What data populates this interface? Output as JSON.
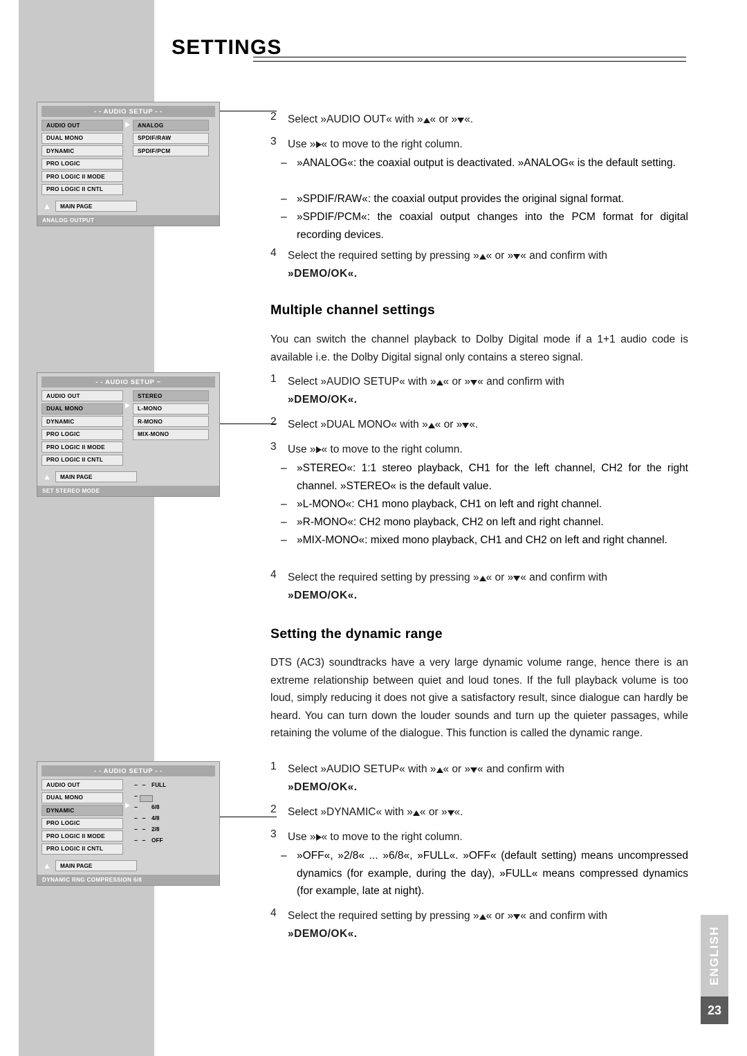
{
  "header": {
    "title": "SETTINGS"
  },
  "footer": {
    "language_tab": "ENGLISH",
    "page_number": "23"
  },
  "osd_panels": [
    {
      "title": "- - AUDIO SETUP - -",
      "left_items": [
        "AUDIO OUT",
        "DUAL MONO",
        "DYNAMIC",
        "PRO LOGIC",
        "PRO LOGIC II MODE",
        "PRO LOGIC II CNTL"
      ],
      "selected_left": "AUDIO OUT",
      "right_items": [
        "ANALOG",
        "SPDIF/RAW",
        "SPDIF/PCM"
      ],
      "selected_right": "ANALOG",
      "main_page": "MAIN PAGE",
      "status": "ANALOG OUTPUT"
    },
    {
      "title": "- - AUDIO SETUP ~",
      "left_items": [
        "AUDIO OUT",
        "DUAL MONO",
        "DYNAMIC",
        "PRO LOGIC",
        "PRO LOGIC II MODE",
        "PRO LOGIC II CNTL"
      ],
      "selected_left": "DUAL MONO",
      "right_items": [
        "STEREO",
        "L-MONO",
        "R-MONO",
        "MIX-MONO"
      ],
      "selected_right": "STEREO",
      "main_page": "MAIN PAGE",
      "status": "SET STEREO MODE"
    },
    {
      "title": "- - AUDIO SETUP - -",
      "left_items": [
        "AUDIO OUT",
        "DUAL MONO",
        "DYNAMIC",
        "PRO LOGIC",
        "PRO LOGIC II MODE",
        "PRO LOGIC II CNTL"
      ],
      "selected_left": "DYNAMIC",
      "scale_labels": [
        "FULL",
        "6/8",
        "4/8",
        "2/8",
        "OFF"
      ],
      "main_page": "MAIN PAGE",
      "status": "DYNAMIC RNG COMPRESSION 6/8"
    }
  ],
  "content": {
    "step2_audioout": {
      "num": "2",
      "text_a": "Select »AUDIO OUT« with »",
      "text_b": "« or »",
      "text_c": "«."
    },
    "step3_right_column": {
      "num": "3",
      "text_a": "Use »",
      "text_b": "« to move to the right column."
    },
    "bullets_audioout": [
      "»ANALOG«: the coaxial output is deactivated. »ANALOG« is the default setting.",
      "»SPDIF/RAW«: the coaxial output provides the original signal format.",
      "»SPDIF/PCM«: the coaxial output changes into the PCM format for digital recording devices."
    ],
    "step4": {
      "num": "4",
      "text_a": "Select the required setting by pressing »",
      "text_b": "« or »",
      "text_c": "« and confirm with",
      "demo_ok": "»DEMO/OK«."
    },
    "section_multiple": {
      "heading": "Multiple channel settings",
      "paragraph": "You can switch the channel playback to Dolby Digital mode if a 1+1 audio code is available i.e. the Dolby Digital signal only contains a stereo signal."
    },
    "step1_audiosetup": {
      "num": "1",
      "text_a": "Select »AUDIO SETUP« with »",
      "text_b": "« or »",
      "text_c": "« and confirm with",
      "demo_ok": "»DEMO/OK«."
    },
    "step2_dualmono": {
      "num": "2",
      "text_a": "Select »DUAL MONO« with »",
      "text_b": "« or »",
      "text_c": "«."
    },
    "bullets_dualmono": [
      "»STEREO«: 1:1 stereo playback, CH1 for the left channel, CH2 for the right channel. »STEREO« is the default value.",
      "»L-MONO«: CH1 mono playback, CH1 on left and right channel.",
      "»R-MONO«: CH2 mono playback, CH2 on left and right channel.",
      "»MIX-MONO«: mixed mono playback, CH1 and CH2 on left and right channel."
    ],
    "section_dynamic": {
      "heading": "Setting the dynamic range",
      "paragraph": "DTS (AC3) soundtracks have a very large dynamic volume range, hence there is an extreme relationship between quiet and loud tones. If the full playback volume is too loud, simply reducing it does not give a satisfactory result, since dialogue can hardly be heard. You can turn down the louder sounds and turn up the quieter passages, while retaining the volume of the dialogue. This function is called the dynamic range."
    },
    "step2_dynamic": {
      "num": "2",
      "text_a": "Select »DYNAMIC« with »",
      "text_b": "« or »",
      "text_c": "«."
    },
    "bullet_dynamic": "»OFF«, »2/8« ... »6/8«, »FULL«. »OFF« (default setting) means uncompressed dynamics (for example, during the day), »FULL« means compressed dynamics (for example, late at night)."
  }
}
